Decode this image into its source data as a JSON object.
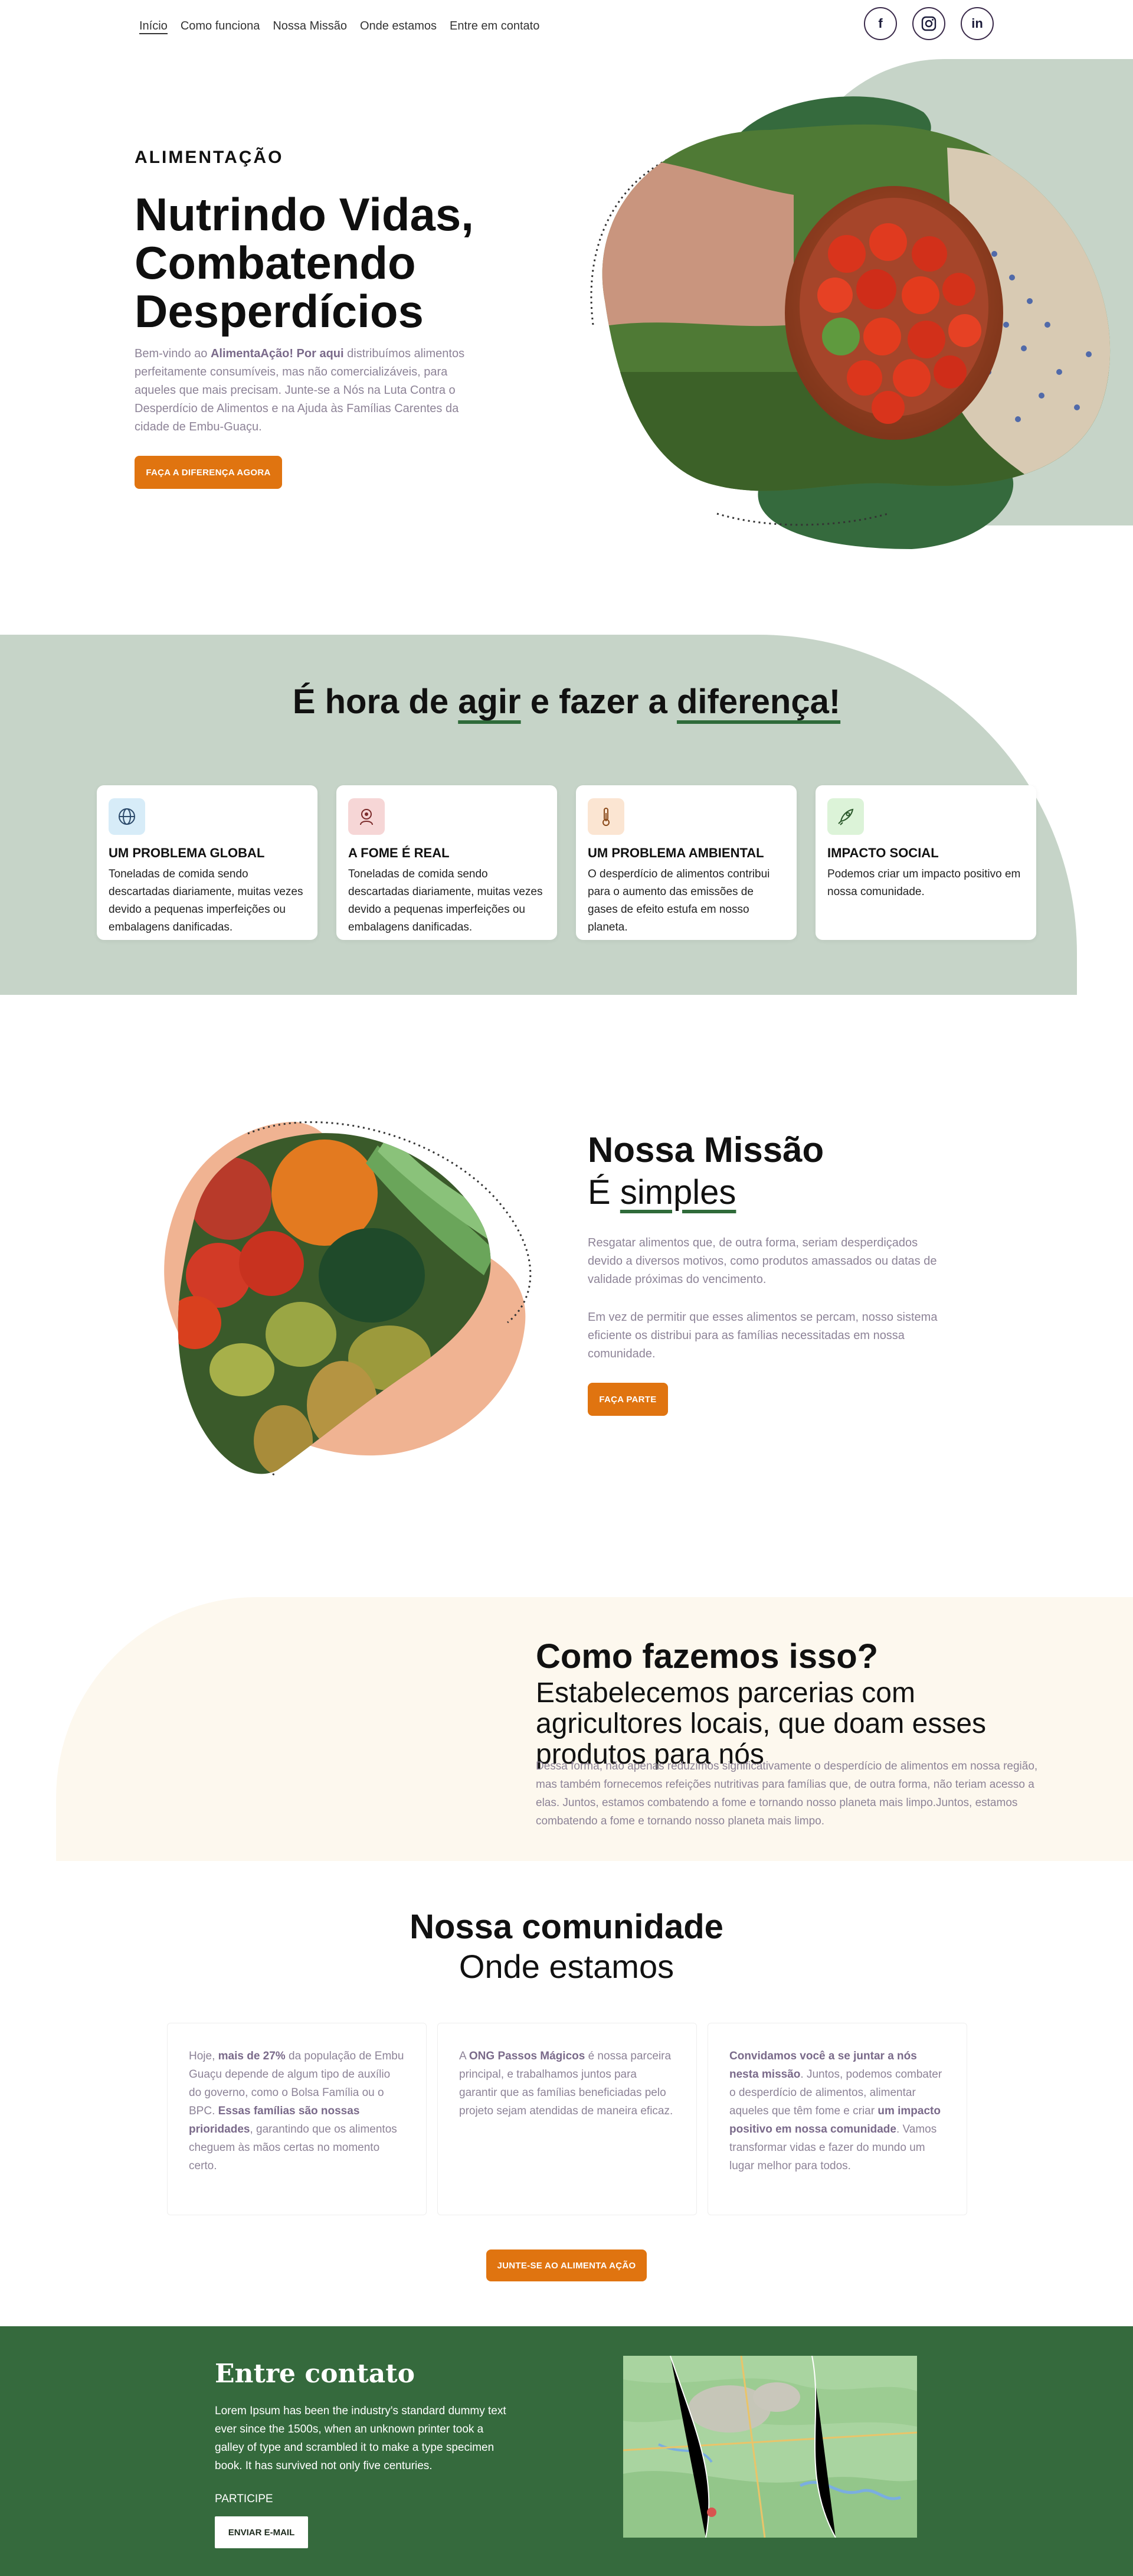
{
  "nav": {
    "links": [
      "Início",
      "Como funciona",
      "Nossa Missão",
      "Onde estamos",
      "Entre em contato"
    ],
    "social": [
      "f",
      "in"
    ]
  },
  "hero": {
    "eyebrow": "ALIMENTAÇÃO",
    "title": "Nutrindo Vidas, Combatendo Desperdícios",
    "text_pre": "Bem-vindo ao ",
    "text_bold": "AlimentaAção! Por aqui",
    "text_post": " distribuímos alimentos perfeitamente consumíveis, mas não comercializáveis, para aqueles que mais precisam. Junte-se a Nós na Luta Contra o Desperdício de Alimentos e na Ajuda às Famílias Carentes da cidade de Embu-Guaçu.",
    "button": "FAÇA A DIFERENÇA AGORA"
  },
  "agir": {
    "title_pre": "É hora de ",
    "title_ul1": "agir",
    "title_mid": " e fazer a ",
    "title_ul2": "diferença!",
    "cards": [
      {
        "title": "UM PROBLEMA GLOBAL",
        "text": "Toneladas de comida sendo descartadas diariamente, muitas vezes devido a pequenas imperfeições ou embalagens danificadas.",
        "icon": "globe-icon",
        "color": "#d7ecf8"
      },
      {
        "title": "A FOME É REAL",
        "text": "Toneladas de comida sendo descartadas diariamente, muitas vezes devido a pequenas imperfeições ou embalagens danificadas.",
        "icon": "hunger-icon",
        "color": "#f6d6d6"
      },
      {
        "title": "UM PROBLEMA AMBIENTAL",
        "text": "O desperdício de alimentos contribui para o aumento das emissões de gases de efeito estufa em nosso planeta.",
        "icon": "thermometer-icon",
        "color": "#fbe5d2"
      },
      {
        "title": "IMPACTO SOCIAL",
        "text": "Podemos criar um impacto positivo em nossa comunidade.",
        "icon": "rocket-icon",
        "color": "#dcf3d8"
      }
    ]
  },
  "missao": {
    "title": "Nossa Missão",
    "sub_pre": "É ",
    "sub_ul": "simples",
    "p1": "Resgatar alimentos que, de outra forma, seriam desperdiçados devido a diversos motivos, como produtos amassados ou datas de validade próximas do vencimento.",
    "p2": "Em vez de permitir que esses alimentos se percam, nosso sistema eficiente os distribui para as famílias necessitadas em nossa comunidade.",
    "button": "FAÇA PARTE"
  },
  "como": {
    "title": "Como fazemos isso?",
    "sub": "Estabelecemos parcerias com agricultores locais, que doam esses produtos para nós",
    "text": "Dessa forma, não apenas reduzimos significativamente o desperdício de alimentos em nossa região, mas também fornecemos refeições nutritivas para famílias que, de outra forma, não teriam acesso a elas. Juntos, estamos combatendo a fome e tornando nosso planeta mais limpo.Juntos, estamos combatendo a fome e tornando nosso planeta mais limpo."
  },
  "comunidade": {
    "title": "Nossa comunidade",
    "sub": "Onde estamos",
    "card1_a": "Hoje, ",
    "card1_b": "mais de 27%",
    "card1_c": " da população de Embu Guaçu depende de algum tipo de auxílio do governo, como o Bolsa Família ou o BPC. ",
    "card1_d": "Essas famílias são nossas prioridades",
    "card1_e": ", garantindo que os alimentos cheguem às mãos certas no momento certo.",
    "card2_a": "A ",
    "card2_b": "ONG Passos Mágicos",
    "card2_c": " é nossa parceira principal, e trabalhamos juntos para garantir que as famílias beneficiadas pelo projeto sejam atendidas de maneira eficaz.",
    "card3_a": "Convidamos você a se juntar a nós nesta missão",
    "card3_b": ". Juntos, podemos combater o desperdício de alimentos, alimentar aqueles que têm fome e criar ",
    "card3_c": "um impacto positivo em nossa comunidade",
    "card3_d": ". Vamos transformar vidas e fazer do mundo um lugar melhor para todos.",
    "button": "JUNTE-SE AO ALIMENTA AÇÃO"
  },
  "contato": {
    "title": "Entre contato",
    "text": "Lorem Ipsum has been the industry's standard dummy text ever since the 1500s, when an unknown printer took a galley of type and scrambled it to make a type specimen book. It has survived not only five centuries.",
    "label": "PARTICIPE",
    "button": "ENVIAR E-MAIL"
  },
  "colors": {
    "orange": "#e07410",
    "green": "#356a3d",
    "sage": "#c6d4c8",
    "cream": "#fdf8ee"
  }
}
